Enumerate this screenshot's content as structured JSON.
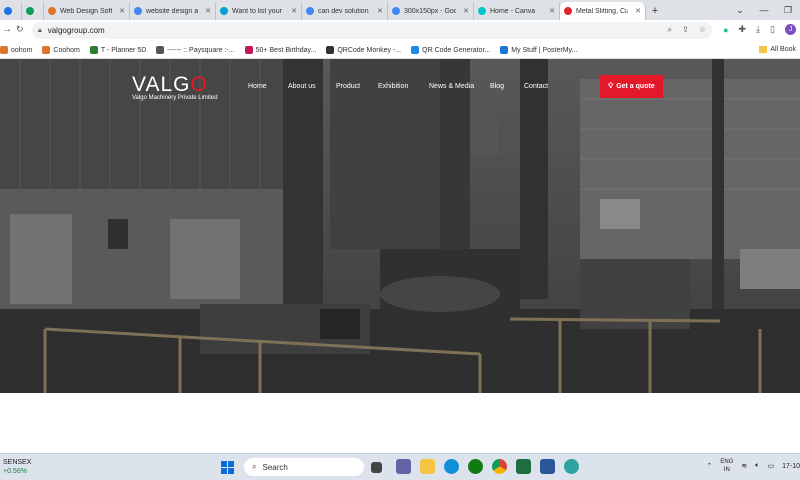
{
  "browser": {
    "tabs": [
      {
        "title": "",
        "icon": "shield-icon",
        "color": "#1a73e8"
      },
      {
        "title": "",
        "icon": "dollar-icon",
        "color": "#0f9d58"
      },
      {
        "title": "Web Design Softw",
        "icon": "globe-icon",
        "color": "#e0742b"
      },
      {
        "title": "website design an",
        "icon": "google-icon",
        "color": "#4285f4"
      },
      {
        "title": "Want to list your",
        "icon": "drop-icon",
        "color": "#00a2d3"
      },
      {
        "title": "can dev solution",
        "icon": "google-icon",
        "color": "#4285f4"
      },
      {
        "title": "300x150px - Goo",
        "icon": "google-icon",
        "color": "#4285f4"
      },
      {
        "title": "Home - Canva",
        "icon": "canva-icon",
        "color": "#00c4cc"
      },
      {
        "title": "Metal Slitting, Cu",
        "icon": "valgo-icon",
        "color": "#e0242b",
        "active": true
      }
    ],
    "new_tab": "+",
    "url": "valgogroup.com",
    "bookmarks": [
      {
        "label": "oohom",
        "color": "#e0742b"
      },
      {
        "label": "Coohom",
        "color": "#e0742b"
      },
      {
        "label": "T - Planner 5D",
        "color": "#2e7d32"
      },
      {
        "label": "------ :: Paysquare :-...",
        "color": "#555555"
      },
      {
        "label": "50+ Best Birthday...",
        "color": "#c2185b"
      },
      {
        "label": "QRCode Monkey -...",
        "color": "#333333"
      },
      {
        "label": "QR Code Generator...",
        "color": "#1e88e5"
      },
      {
        "label": "My Stuff | PosterMy...",
        "color": "#1976d2"
      }
    ],
    "all_bookmarks": "All Book"
  },
  "site": {
    "logo_text": "VALGO",
    "logo_tagline": "Valgo Machinery Private Limited",
    "nav": [
      {
        "label": "Home",
        "active": true
      },
      {
        "label": "About us"
      },
      {
        "label": "Product"
      },
      {
        "label": "Exhibition"
      },
      {
        "label": "News & Media"
      },
      {
        "label": "Blog"
      },
      {
        "label": "Contact"
      }
    ],
    "cta": "Get a quote",
    "accent": "#e5182a"
  },
  "taskbar": {
    "stock_name": "SENSEX",
    "stock_change": "+0.56%",
    "search_placeholder": "Search",
    "lang_top": "ENG",
    "lang_bottom": "IN",
    "clock": "17-10"
  }
}
